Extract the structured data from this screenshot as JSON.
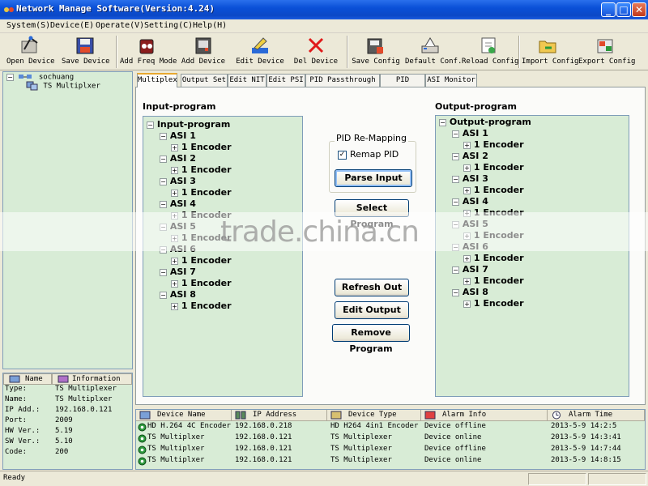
{
  "window": {
    "title": "Network Manage Software(Version:4.24)"
  },
  "menu": [
    "System(S)",
    "Device(E)",
    "Operate(V)",
    "Setting(C)",
    "Help(H)"
  ],
  "toolbar": [
    {
      "label": "Open Device",
      "icon": "open-device-icon"
    },
    {
      "label": "Save Device",
      "icon": "save-device-icon"
    },
    {
      "label": "Add Freq Mode",
      "icon": "add-freq-mode-icon"
    },
    {
      "label": "Add Device",
      "icon": "add-device-icon"
    },
    {
      "label": "Edit Device",
      "icon": "edit-device-icon"
    },
    {
      "label": "Del Device",
      "icon": "delete-icon"
    },
    {
      "label": "Save Config",
      "icon": "save-config-icon"
    },
    {
      "label": "Default Conf.",
      "icon": "default-config-icon"
    },
    {
      "label": "Reload Config",
      "icon": "reload-config-icon"
    },
    {
      "label": "Import Config",
      "icon": "import-config-icon"
    },
    {
      "label": "Export Config",
      "icon": "export-config-icon"
    }
  ],
  "tree": {
    "root": "sochuang",
    "child": "TS Multiplxer"
  },
  "info": {
    "headers": [
      "Name",
      "Information"
    ],
    "rows": [
      {
        "key": "Type:",
        "value": "TS Multiplexer"
      },
      {
        "key": "Name:",
        "value": "TS Multiplxer"
      },
      {
        "key": "IP Add.:",
        "value": "192.168.0.121"
      },
      {
        "key": "Port:",
        "value": "2009"
      },
      {
        "key": "HW Ver.:",
        "value": "5.19"
      },
      {
        "key": "SW Ver.:",
        "value": "5.10"
      },
      {
        "key": "Code:",
        "value": "200"
      }
    ]
  },
  "tabs": [
    "Multiplex",
    "Output Set",
    "Edit NIT",
    "Edit PSI",
    "PID Passthrough",
    "PID Filter",
    "ASI Monitor"
  ],
  "input_program": {
    "label": "Input-program",
    "root": "Input-program",
    "rows": [
      {
        "text": "ASI 1",
        "level": 1,
        "sign": "−"
      },
      {
        "text": "1 Encoder",
        "level": 2,
        "sign": "+"
      },
      {
        "text": "ASI 2",
        "level": 1,
        "sign": "−"
      },
      {
        "text": "1 Encoder",
        "level": 2,
        "sign": "+"
      },
      {
        "text": "ASI 3",
        "level": 1,
        "sign": "−"
      },
      {
        "text": "1 Encoder",
        "level": 2,
        "sign": "+"
      },
      {
        "text": "ASI 4",
        "level": 1,
        "sign": "−"
      },
      {
        "text": "1 Encoder",
        "level": 2,
        "sign": "+"
      },
      {
        "text": "ASI 5",
        "level": 1,
        "sign": "−"
      },
      {
        "text": "1 Encoder",
        "level": 2,
        "sign": "+"
      },
      {
        "text": "ASI 6",
        "level": 1,
        "sign": "−"
      },
      {
        "text": "1 Encoder",
        "level": 2,
        "sign": "+"
      },
      {
        "text": "ASI 7",
        "level": 1,
        "sign": "−"
      },
      {
        "text": "1 Encoder",
        "level": 2,
        "sign": "+"
      },
      {
        "text": "ASI 8",
        "level": 1,
        "sign": "−"
      },
      {
        "text": "1 Encoder",
        "level": 2,
        "sign": "+"
      }
    ]
  },
  "output_program": {
    "label": "Output-program",
    "root": "Output-program",
    "rows": [
      {
        "text": "ASI 1",
        "level": 1,
        "sign": "−"
      },
      {
        "text": "1 Encoder",
        "level": 2,
        "sign": "+"
      },
      {
        "text": "ASI 2",
        "level": 1,
        "sign": "−"
      },
      {
        "text": "1 Encoder",
        "level": 2,
        "sign": "+"
      },
      {
        "text": "ASI 3",
        "level": 1,
        "sign": "−"
      },
      {
        "text": "1 Encoder",
        "level": 2,
        "sign": "+"
      },
      {
        "text": "ASI 4",
        "level": 1,
        "sign": "−"
      },
      {
        "text": "1 Encoder",
        "level": 2,
        "sign": "+"
      },
      {
        "text": "ASI 5",
        "level": 1,
        "sign": "−"
      },
      {
        "text": "1 Encoder",
        "level": 2,
        "sign": "+"
      },
      {
        "text": "ASI 6",
        "level": 1,
        "sign": "−"
      },
      {
        "text": "1 Encoder",
        "level": 2,
        "sign": "+"
      },
      {
        "text": "ASI 7",
        "level": 1,
        "sign": "−"
      },
      {
        "text": "1 Encoder",
        "level": 2,
        "sign": "+"
      },
      {
        "text": "ASI 8",
        "level": 1,
        "sign": "−"
      },
      {
        "text": "1 Encoder",
        "level": 2,
        "sign": "+"
      }
    ]
  },
  "pid_remap": {
    "group_title": "PID Re-Mapping",
    "checkbox_label": "Remap PID",
    "checked": true,
    "parse_label": "Parse Input"
  },
  "buttons": {
    "select_program": "Select Program",
    "refresh_out": "Refresh Out",
    "edit_output": "Edit Output",
    "remove_program": "Remove Program"
  },
  "device_list": {
    "headers": [
      {
        "label": "Device Name",
        "icon": "device-icon"
      },
      {
        "label": "IP Address",
        "icon": "network-icon"
      },
      {
        "label": "Device Type",
        "icon": "device-type-icon"
      },
      {
        "label": "Alarm Info",
        "icon": "alarm-icon"
      },
      {
        "label": "Alarm Time",
        "icon": "clock-icon"
      }
    ],
    "rows": [
      [
        "HD H.264 4C Encoder",
        "192.168.0.218",
        "HD H264 4in1 Encoder",
        "Device offline",
        "2013-5-9 14:2:5"
      ],
      [
        "TS Multiplxer",
        "192.168.0.121",
        "TS Multiplexer",
        "Device online",
        "2013-5-9 14:3:41"
      ],
      [
        "TS Multiplxer",
        "192.168.0.121",
        "TS Multiplexer",
        "Device offline",
        "2013-5-9 14:7:44"
      ],
      [
        "TS Multiplxer",
        "192.168.0.121",
        "TS Multiplexer",
        "Device online",
        "2013-5-9 14:8:15"
      ]
    ]
  },
  "status": {
    "text": "Ready"
  },
  "watermark": "trade.china.cn",
  "colors": {
    "titlebar": "#0a50d8",
    "panel_green": "#d8ecd6",
    "window_bg": "#ece9d8"
  }
}
